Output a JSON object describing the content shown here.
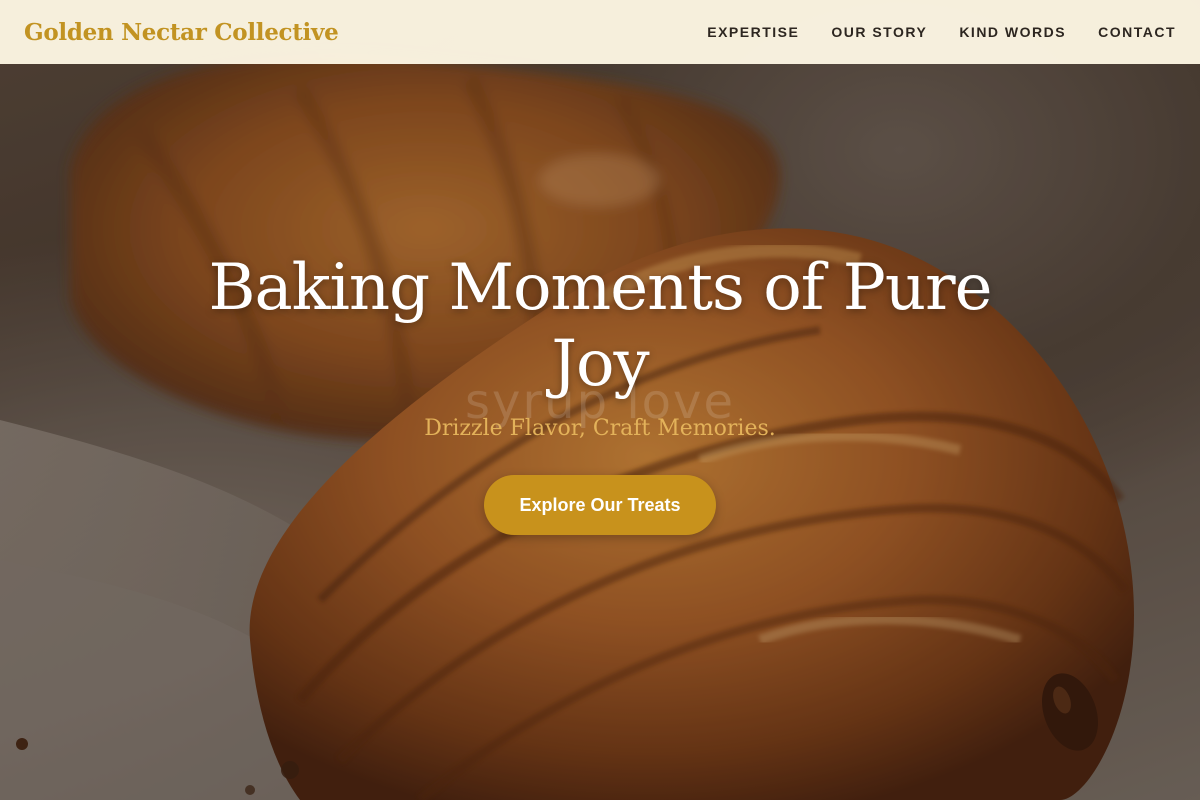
{
  "brand": {
    "name": "Golden Nectar Collective"
  },
  "nav": {
    "items": [
      {
        "label": "EXPERTISE"
      },
      {
        "label": "OUR STORY"
      },
      {
        "label": "KIND WORDS"
      },
      {
        "label": "CONTACT"
      }
    ]
  },
  "hero": {
    "headline": "Baking Moments of Pure Joy",
    "watermark": "syrup love",
    "tagline": "Drizzle Flavor, Craft Memories.",
    "cta_label": "Explore Our Treats",
    "image": "croissant-pastry-photo"
  },
  "colors": {
    "brand": "#c29322",
    "navbar_bg": "#fcf5e2",
    "cta_bg": "#c8921c",
    "tagline": "#e3b25a",
    "nav_text": "#2d2620"
  }
}
